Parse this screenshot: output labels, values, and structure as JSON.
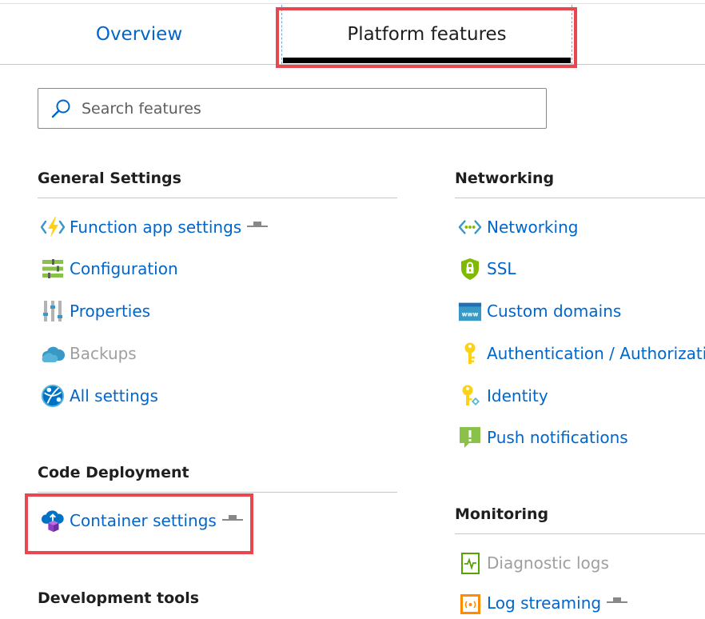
{
  "tabs": {
    "overview": "Overview",
    "platform": "Platform features"
  },
  "search": {
    "placeholder": "Search features"
  },
  "sections": {
    "general": {
      "title": "General Settings",
      "items": [
        {
          "label": "Function app settings",
          "icon": "function-bolt-icon"
        },
        {
          "label": "Configuration",
          "icon": "configuration-sliders-icon"
        },
        {
          "label": "Properties",
          "icon": "properties-bars-icon"
        },
        {
          "label": "Backups",
          "icon": "cloud-backup-icon",
          "disabled": true
        },
        {
          "label": "All settings",
          "icon": "all-settings-globe-icon"
        }
      ]
    },
    "code_deployment": {
      "title": "Code Deployment",
      "items": [
        {
          "label": "Container settings",
          "icon": "container-cloud-icon"
        }
      ]
    },
    "development_tools": {
      "title": "Development tools"
    },
    "networking": {
      "title": "Networking",
      "items": [
        {
          "label": "Networking",
          "icon": "networking-arrows-icon"
        },
        {
          "label": "SSL",
          "icon": "ssl-shield-icon"
        },
        {
          "label": "Custom domains",
          "icon": "www-domain-icon"
        },
        {
          "label": "Authentication / Authorizatio",
          "icon": "key-icon"
        },
        {
          "label": "Identity",
          "icon": "identity-key-icon"
        },
        {
          "label": "Push notifications",
          "icon": "push-notification-icon"
        }
      ]
    },
    "monitoring": {
      "title": "Monitoring",
      "items": [
        {
          "label": "Diagnostic logs",
          "icon": "diagnostic-logs-icon",
          "disabled": true
        },
        {
          "label": "Log streaming",
          "icon": "log-streaming-icon"
        }
      ]
    }
  },
  "colors": {
    "link": "#0066cc",
    "disabled": "#a19f9d",
    "highlight": "#e8474f",
    "text": "#201f1e"
  }
}
